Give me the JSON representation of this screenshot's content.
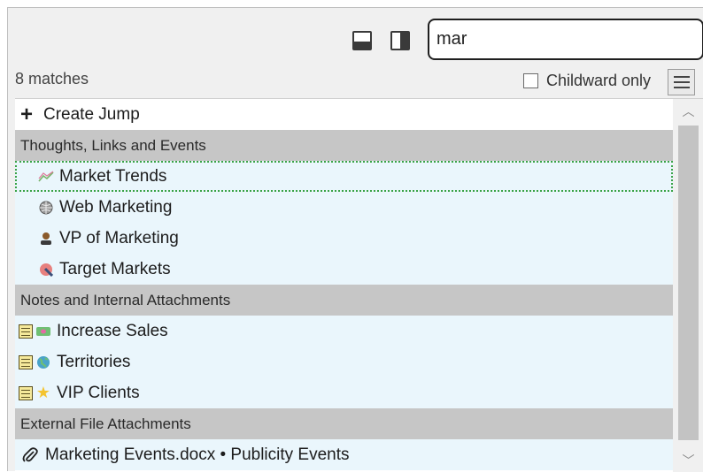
{
  "search": {
    "value": "mar"
  },
  "toolbar": {
    "layout_bottom_icon": "layout-bottom-icon",
    "layout_right_icon": "layout-right-icon"
  },
  "status": {
    "matches": "8 matches"
  },
  "filter": {
    "childward_label": "Childward only",
    "checked": false
  },
  "menu_icon": "hamburger-icon",
  "list": {
    "create_jump": "Create Jump",
    "groups": [
      {
        "header": "Thoughts, Links and Events",
        "items": [
          {
            "label": "Market Trends",
            "icon": "trend-icon",
            "selected": true
          },
          {
            "label": "Web Marketing",
            "icon": "globe-icon"
          },
          {
            "label": "VP of Marketing",
            "icon": "person-icon"
          },
          {
            "label": "Target Markets",
            "icon": "target-icon"
          }
        ]
      },
      {
        "header": "Notes and Internal Attachments",
        "items": [
          {
            "label": "Increase Sales",
            "icon": "money-icon",
            "note": true
          },
          {
            "label": "Territories",
            "icon": "globe-icon",
            "note": true
          },
          {
            "label": "VIP Clients",
            "icon": "star-icon",
            "note": true
          }
        ]
      },
      {
        "header": "External File Attachments",
        "items": [
          {
            "label": "Marketing Events.docx • Publicity Events",
            "icon": "paperclip-icon"
          }
        ]
      }
    ]
  },
  "colors": {
    "item_bg": "#eaf6fc",
    "header_bg": "#c6c6c6",
    "selection_border": "#3aa346"
  }
}
